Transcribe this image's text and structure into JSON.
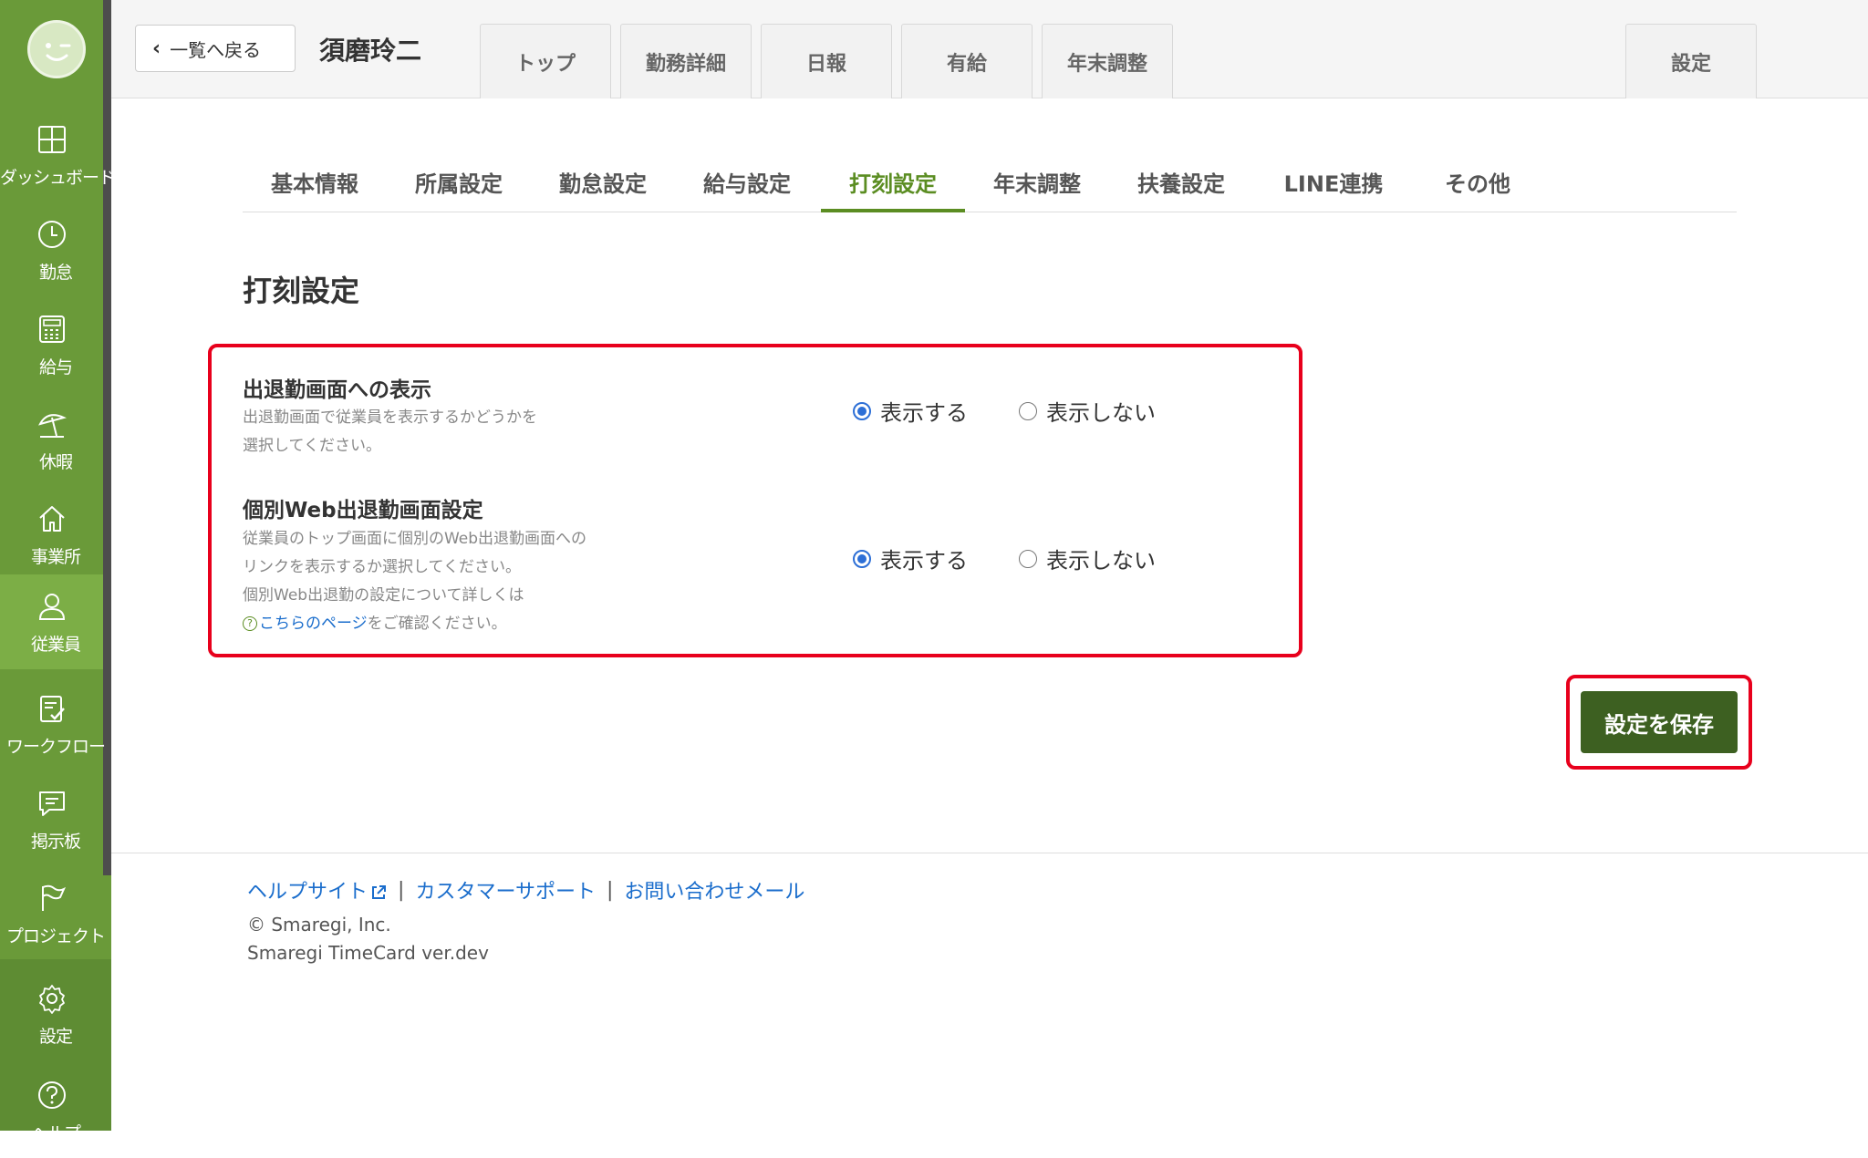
{
  "sidebar": {
    "items": [
      {
        "label": "ダッシュボード",
        "icon": "dashboard-icon"
      },
      {
        "label": "勤怠",
        "icon": "clock-icon"
      },
      {
        "label": "給与",
        "icon": "calculator-icon"
      },
      {
        "label": "休暇",
        "icon": "beach-umbrella-icon"
      },
      {
        "label": "事業所",
        "icon": "home-icon"
      },
      {
        "label": "従業員",
        "icon": "person-icon"
      },
      {
        "label": "ワークフロー",
        "icon": "clipboard-check-icon"
      },
      {
        "label": "掲示板",
        "icon": "chat-icon"
      },
      {
        "label": "プロジェクト",
        "icon": "flag-icon"
      },
      {
        "label": "設定",
        "icon": "gear-icon"
      },
      {
        "label": "ヘルプ",
        "icon": "help-icon"
      }
    ],
    "active_color": "#7cae46",
    "bg_color": "#6a9a39"
  },
  "header": {
    "back_label": "一覧へ戻る",
    "employee_name": "須磨玲二",
    "tabs": [
      "トップ",
      "勤務詳細",
      "日報",
      "有給",
      "年末調整"
    ],
    "settings_tab": "設定"
  },
  "subtabs": {
    "items": [
      "基本情報",
      "所属設定",
      "勤怠設定",
      "給与設定",
      "打刻設定",
      "年末調整",
      "扶養設定",
      "LINE連携",
      "その他"
    ],
    "active": "打刻設定"
  },
  "page_title": "打刻設定",
  "settings": {
    "display": {
      "title": "出退勤画面への表示",
      "desc_line1": "出退勤画面で従業員を表示するかどうかを",
      "desc_line2": "選択してください。",
      "option_show": "表示する",
      "option_hide": "表示しない",
      "selected": "表示する"
    },
    "web": {
      "title": "個別Web出退勤画面設定",
      "desc_line1": "従業員のトップ画面に個別のWeb出退勤画面への",
      "desc_line2": "リンクを表示するか選択してください。",
      "desc_line3": "個別Web出退勤の設定について詳しくは",
      "help_mark": "?",
      "link_text": "こちらのページ",
      "desc_tail": "をご確認ください。",
      "option_show": "表示する",
      "option_hide": "表示しない",
      "selected": "表示する"
    }
  },
  "save_label": "設定を保存",
  "footer": {
    "help_site": "ヘルプサイト",
    "customer_support": "カスタマーサポート",
    "contact_mail": "お問い合わせメール",
    "separator": "|",
    "copyright": "© Smaregi, Inc.",
    "version": "Smaregi TimeCard ver.dev"
  },
  "colors": {
    "accent_green": "#5b8d22",
    "save_button": "#3d6021",
    "highlight_red": "#e8001c",
    "link_blue": "#1a6dcc",
    "radio_blue": "#2d6fd6"
  }
}
